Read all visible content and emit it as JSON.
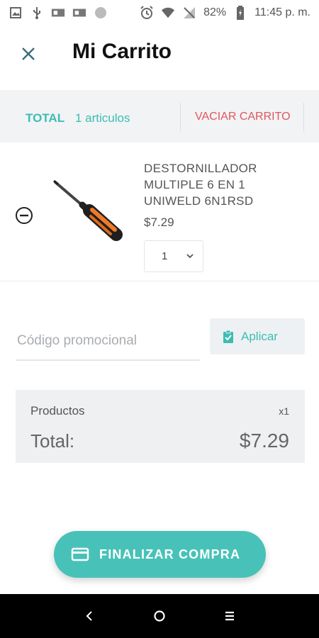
{
  "status_bar": {
    "battery": "82%",
    "time": "11:45 p. m.",
    "left_icons": [
      "image-icon",
      "usb-icon",
      "debug-icon",
      "debug-icon",
      "circle-icon"
    ],
    "right_icons": [
      "alarm-icon",
      "wifi-icon",
      "no-signal-icon",
      "battery-icon"
    ]
  },
  "header": {
    "title": "Mi Carrito",
    "close_icon": "close-icon"
  },
  "summary": {
    "total_label": "TOTAL",
    "count_label": "1 articulos",
    "empty_label": "VACIAR CARRITO"
  },
  "cart": {
    "items": [
      {
        "name": "DESTORNILLADOR MULTIPLE 6 EN 1 UNIWELD 6N1RSD",
        "price": "$7.29",
        "quantity": "1"
      }
    ]
  },
  "promo": {
    "placeholder": "Código promocional",
    "apply_label": "Aplicar"
  },
  "totals": {
    "products_label": "Productos",
    "products_count": "x1",
    "total_label": "Total:",
    "total_amount": "$7.29"
  },
  "checkout": {
    "label": "FINALIZAR COMPRA"
  },
  "colors": {
    "accent": "#48c2b8",
    "accent_text": "#3dbdb2",
    "danger": "#e2555e",
    "panel": "#eef0f2"
  }
}
